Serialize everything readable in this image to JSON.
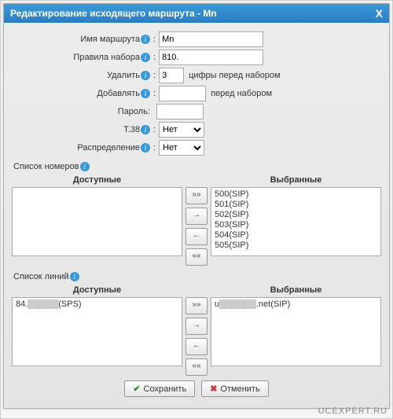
{
  "dialog": {
    "title": "Редактирование исходящего маршрута - Mn",
    "close": "X"
  },
  "fields": {
    "route_name": {
      "label": "Имя маршрута",
      "value": "Mn"
    },
    "dial_pattern": {
      "label": "Правила набора",
      "value": "810."
    },
    "strip": {
      "label": "Удалить",
      "value": "3",
      "suffix": "цифры перед набором"
    },
    "prepend": {
      "label": "Добавлять",
      "value": "",
      "suffix": "перед набором"
    },
    "password": {
      "label": "Пароль:",
      "value": ""
    },
    "t38": {
      "label": "T.38",
      "value": "Нет"
    },
    "distribution": {
      "label": "Распределение",
      "value": "Нет"
    }
  },
  "info_glyph": "i",
  "numbers": {
    "title": "Список номеров",
    "available": {
      "header": "Доступные",
      "items": []
    },
    "selected": {
      "header": "Выбранные",
      "items": [
        "500(SIP)",
        "501(SIP)",
        "502(SIP)",
        "503(SIP)",
        "504(SIP)",
        "505(SIP)"
      ]
    }
  },
  "lines": {
    "title": "Список линий",
    "available": {
      "header": "Доступные",
      "items": [
        "84.▒▒▒▒▒(SPS)"
      ]
    },
    "selected": {
      "header": "Выбранные",
      "items": [
        "u▒▒▒▒▒▒.net(SIP)"
      ]
    }
  },
  "move": {
    "all_r": "»»",
    "one_r": "→",
    "one_l": "←",
    "all_l": "««"
  },
  "footer": {
    "save": "Сохранить",
    "cancel": "Отменить"
  },
  "watermark": "UCEXPERT.RU"
}
